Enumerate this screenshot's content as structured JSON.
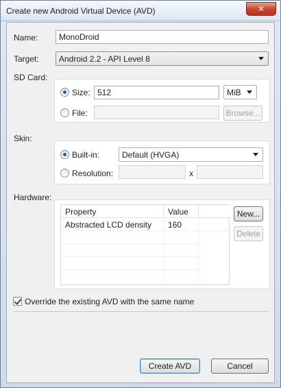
{
  "window": {
    "title": "Create new Android Virtual Device (AVD)",
    "close_glyph": "✕",
    "accent": "#c8402b"
  },
  "fields": {
    "name_label": "Name:",
    "name_value": "MonoDroid",
    "target_label": "Target:",
    "target_value": "Android 2.2 - API Level 8"
  },
  "sdcard": {
    "label": "SD Card:",
    "size_label": "Size:",
    "size_value": "512",
    "unit_value": "MiB",
    "file_label": "File:",
    "file_value": "",
    "browse_label": "Browse..."
  },
  "skin": {
    "label": "Skin:",
    "builtin_label": "Built-in:",
    "builtin_value": "Default (HVGA)",
    "resolution_label": "Resolution:",
    "res_width": "",
    "res_x": "x",
    "res_height": ""
  },
  "hardware": {
    "label": "Hardware:",
    "columns": [
      "Property",
      "Value"
    ],
    "rows": [
      {
        "property": "Abstracted LCD density",
        "value": "160"
      }
    ],
    "new_label": "New...",
    "delete_label": "Delete"
  },
  "override": {
    "label": "Override the existing AVD with the same name",
    "checked": true
  },
  "footer": {
    "create_label": "Create AVD",
    "cancel_label": "Cancel"
  }
}
